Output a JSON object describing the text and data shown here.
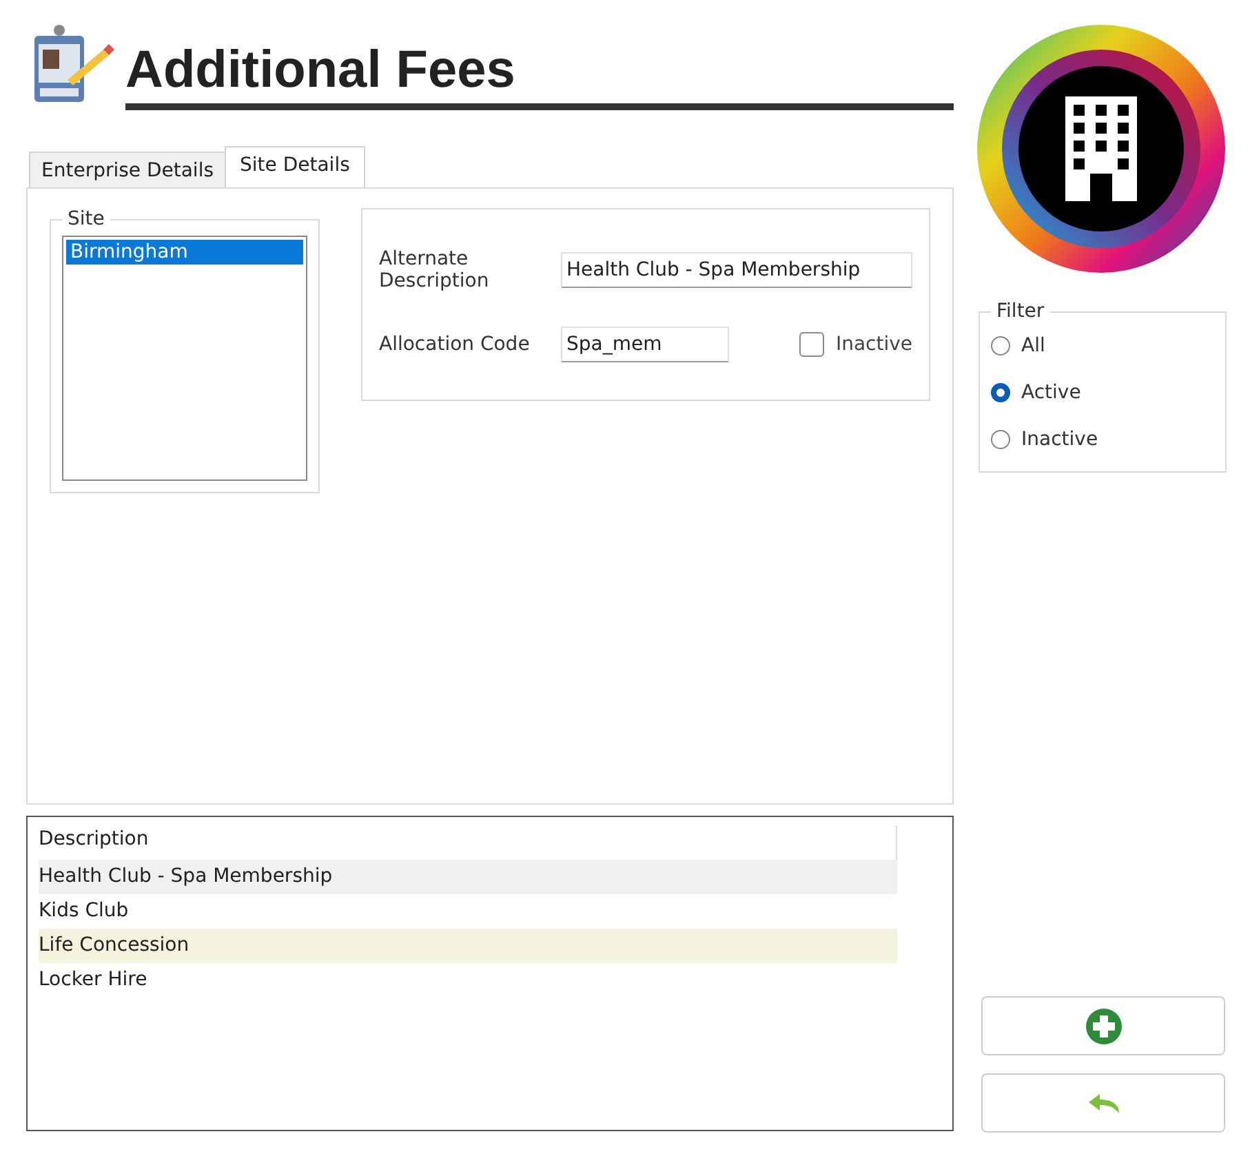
{
  "header": {
    "title": "Additional Fees"
  },
  "tabs": [
    {
      "label": "Enterprise Details",
      "selected": false
    },
    {
      "label": "Site Details",
      "selected": true
    }
  ],
  "site_group": {
    "legend": "Site",
    "items": [
      {
        "label": "Birmingham",
        "selected": true
      }
    ]
  },
  "details": {
    "alternate_description": {
      "label": "Alternate Description",
      "value": "Health Club - Spa Membership"
    },
    "allocation_code": {
      "label": "Allocation Code",
      "value": "Spa_mem"
    },
    "inactive": {
      "label": "Inactive",
      "checked": false
    }
  },
  "filter": {
    "legend": "Filter",
    "options": [
      {
        "label": "All",
        "selected": false
      },
      {
        "label": "Active",
        "selected": true
      },
      {
        "label": "Inactive",
        "selected": false
      }
    ]
  },
  "list": {
    "column": "Description",
    "rows": [
      {
        "text": "Health Club - Spa Membership",
        "selected": true,
        "hovered": false
      },
      {
        "text": "Kids Club",
        "selected": false,
        "hovered": false
      },
      {
        "text": "Life Concession",
        "selected": false,
        "hovered": true
      },
      {
        "text": "Locker Hire",
        "selected": false,
        "hovered": false
      }
    ]
  }
}
